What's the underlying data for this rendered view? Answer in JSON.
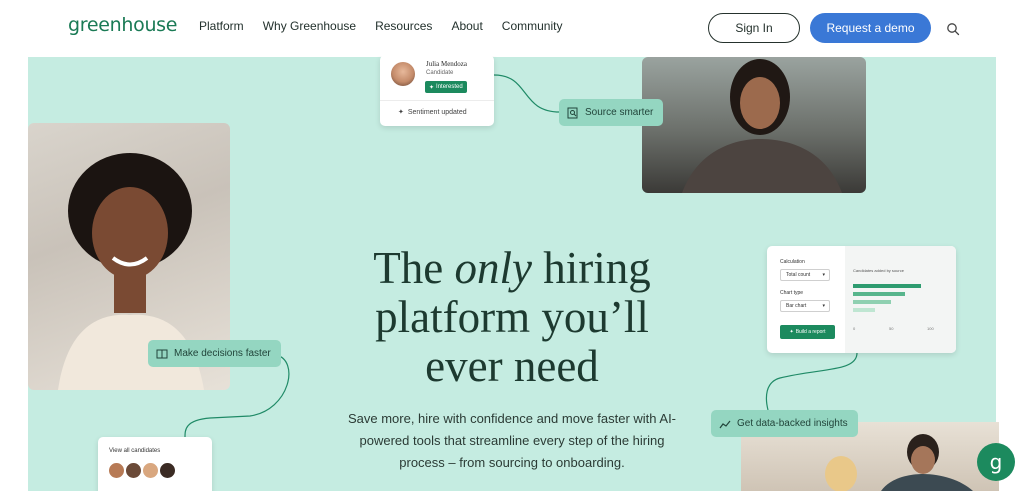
{
  "header": {
    "logo": "greenhouse",
    "nav": [
      "Platform",
      "Why Greenhouse",
      "Resources",
      "About",
      "Community"
    ],
    "sign_in": "Sign In",
    "request_demo": "Request a demo"
  },
  "hero": {
    "headline_pre": "The ",
    "headline_em": "only",
    "headline_post": " hiring platform you’ll ever need",
    "subtext": "Save more, hire with confidence and move faster with AI-powered tools that streamline every step of the hiring process – from sourcing to onboarding."
  },
  "candidate_card": {
    "name": "Julia Mendoza",
    "role": "Candidate",
    "badge": "Interested",
    "status": "Sentiment updated"
  },
  "tags": {
    "source": "Source smarter",
    "decisions": "Make decisions faster",
    "insights": "Get data-backed insights"
  },
  "report_card": {
    "calc_label": "Calculation",
    "calc_value": "Total count",
    "type_label": "Chart type",
    "type_value": "Bar chart",
    "build_button": "Build a report",
    "chart_title": "Candidates added by source",
    "ticks": [
      "0",
      "50",
      "100"
    ]
  },
  "viewall": {
    "title": "View all candidates"
  },
  "colors": {
    "brand_green": "#1c8a5e",
    "hero_bg": "#c5ece1",
    "demo_blue": "#3a78d6",
    "tag_bg": "#94d6c1"
  }
}
